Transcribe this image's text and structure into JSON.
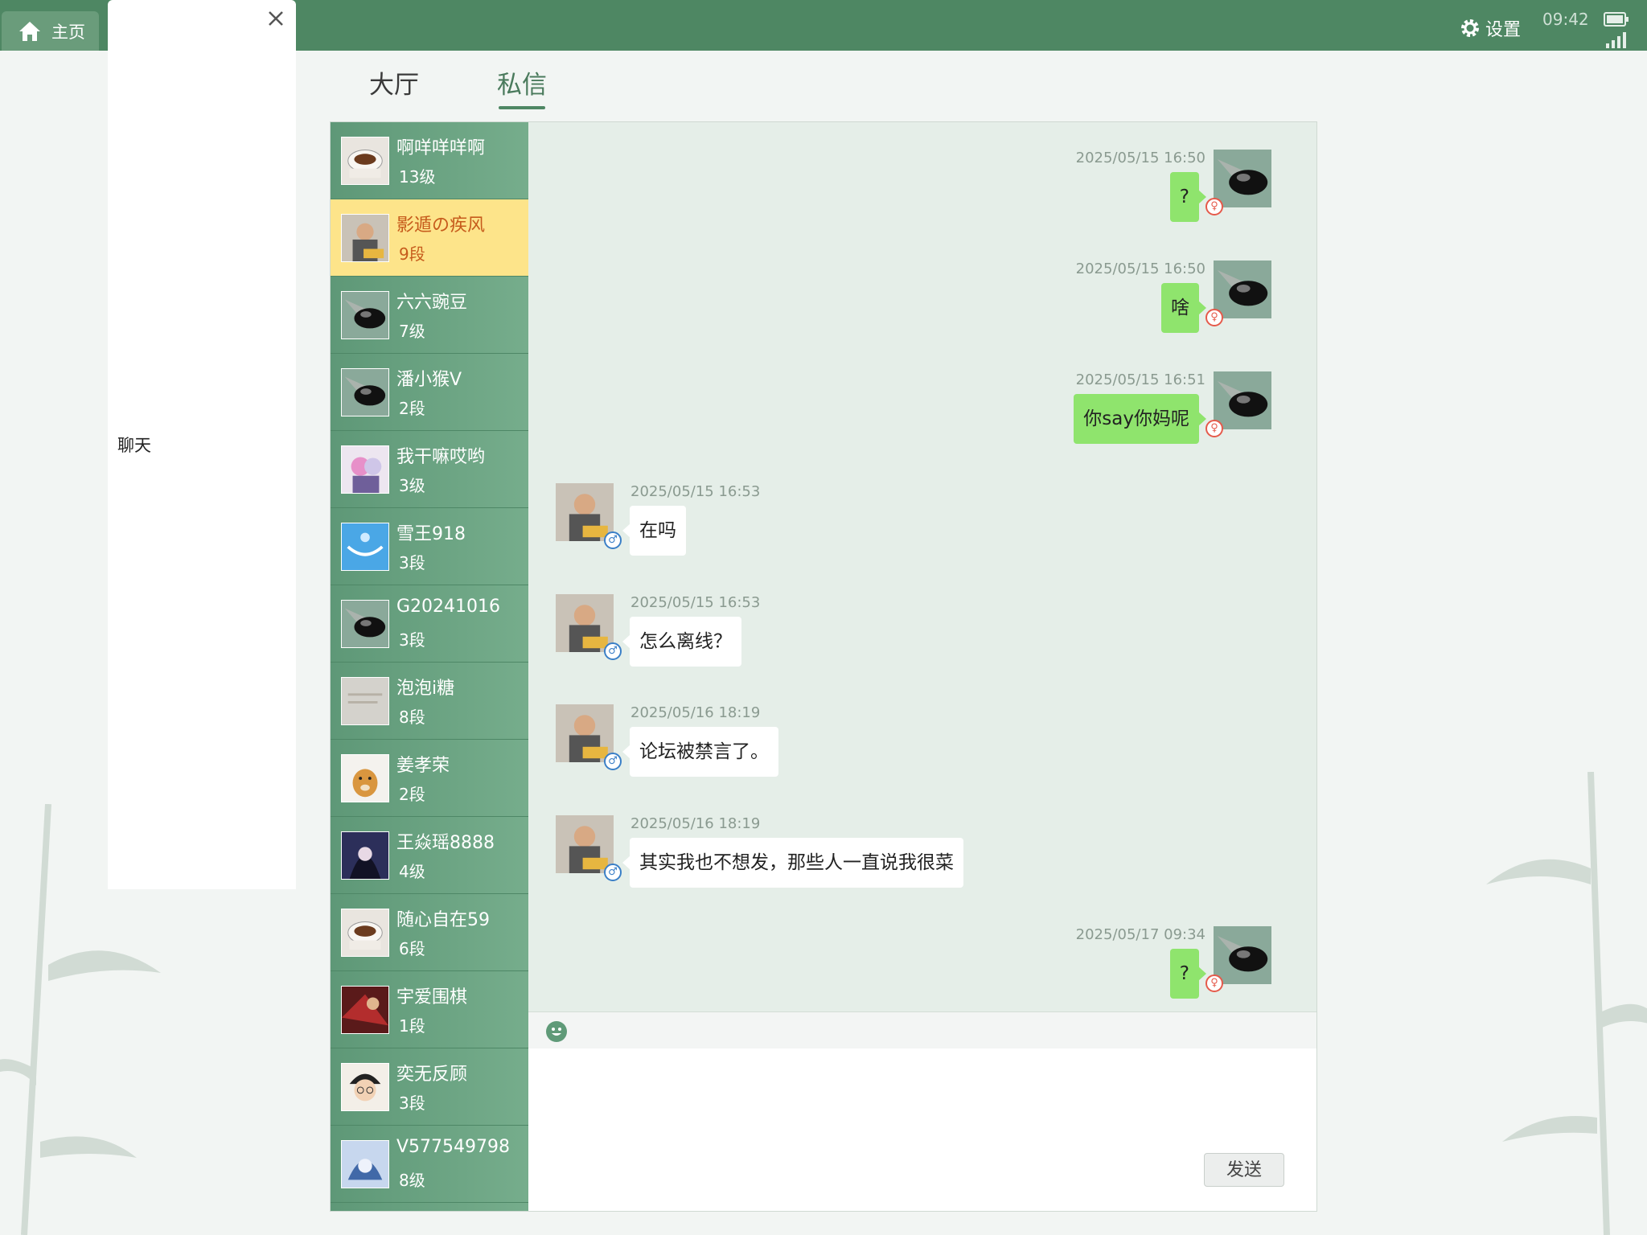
{
  "topbar": {
    "tabs": [
      {
        "label": "主页",
        "icon": "home-icon"
      },
      {
        "label": "聊天",
        "icon": "close-icon"
      }
    ],
    "settings_label": "设置",
    "time": "09:42"
  },
  "page_tabs": [
    {
      "label": "大厅",
      "active": false
    },
    {
      "label": "私信",
      "active": true
    }
  ],
  "contacts": [
    {
      "name": "啊咩咩咩啊",
      "rank": "13级",
      "avatar": "coffee"
    },
    {
      "name": "影遁の疾风",
      "rank": "9段",
      "avatar": "man",
      "active": true
    },
    {
      "name": "六六豌豆",
      "rank": "7级",
      "avatar": "stone"
    },
    {
      "name": "潘小猴V",
      "rank": "2段",
      "avatar": "stone"
    },
    {
      "name": "我干嘛哎哟",
      "rank": "3级",
      "avatar": "anime-pink"
    },
    {
      "name": "雪王918",
      "rank": "3段",
      "avatar": "sky"
    },
    {
      "name": "G20241016",
      "rank": "3段",
      "avatar": "stone"
    },
    {
      "name": "泡泡i糖",
      "rank": "8段",
      "avatar": "paper"
    },
    {
      "name": "姜孝荣",
      "rank": "2段",
      "avatar": "dog"
    },
    {
      "name": "王焱瑶8888",
      "rank": "4级",
      "avatar": "anime-dark"
    },
    {
      "name": "随心自在59",
      "rank": "6段",
      "avatar": "coffee"
    },
    {
      "name": "宇爱围棋",
      "rank": "1段",
      "avatar": "red"
    },
    {
      "name": "奕无反顾",
      "rank": "3段",
      "avatar": "conan"
    },
    {
      "name": "V577549798",
      "rank": "8级",
      "avatar": "anime-blue"
    }
  ],
  "messages": [
    {
      "from": "me",
      "time": "2025/05/15 16:50",
      "text": "?"
    },
    {
      "from": "me",
      "time": "2025/05/15 16:50",
      "text": "啥"
    },
    {
      "from": "me",
      "time": "2025/05/15 16:51",
      "text": "你say你妈呢"
    },
    {
      "from": "them",
      "time": "2025/05/15 16:53",
      "text": "在吗"
    },
    {
      "from": "them",
      "time": "2025/05/15 16:53",
      "text": "怎么离线？"
    },
    {
      "from": "them",
      "time": "2025/05/16 18:19",
      "text": "论坛被禁言了。"
    },
    {
      "from": "them",
      "time": "2025/05/16 18:19",
      "text": "其实我也不想发，那些人一直说我很菜"
    },
    {
      "from": "me",
      "time": "2025/05/17 09:34",
      "text": "?"
    }
  ],
  "compose": {
    "send_label": "发送",
    "emoji_icon": "smiley-icon"
  },
  "colors": {
    "topbar": "#4e8763",
    "sidebar": "#6aa283",
    "active_contact": "#fde48a",
    "my_bubble": "#8fe46d",
    "chat_bg": "#e5eee8"
  }
}
